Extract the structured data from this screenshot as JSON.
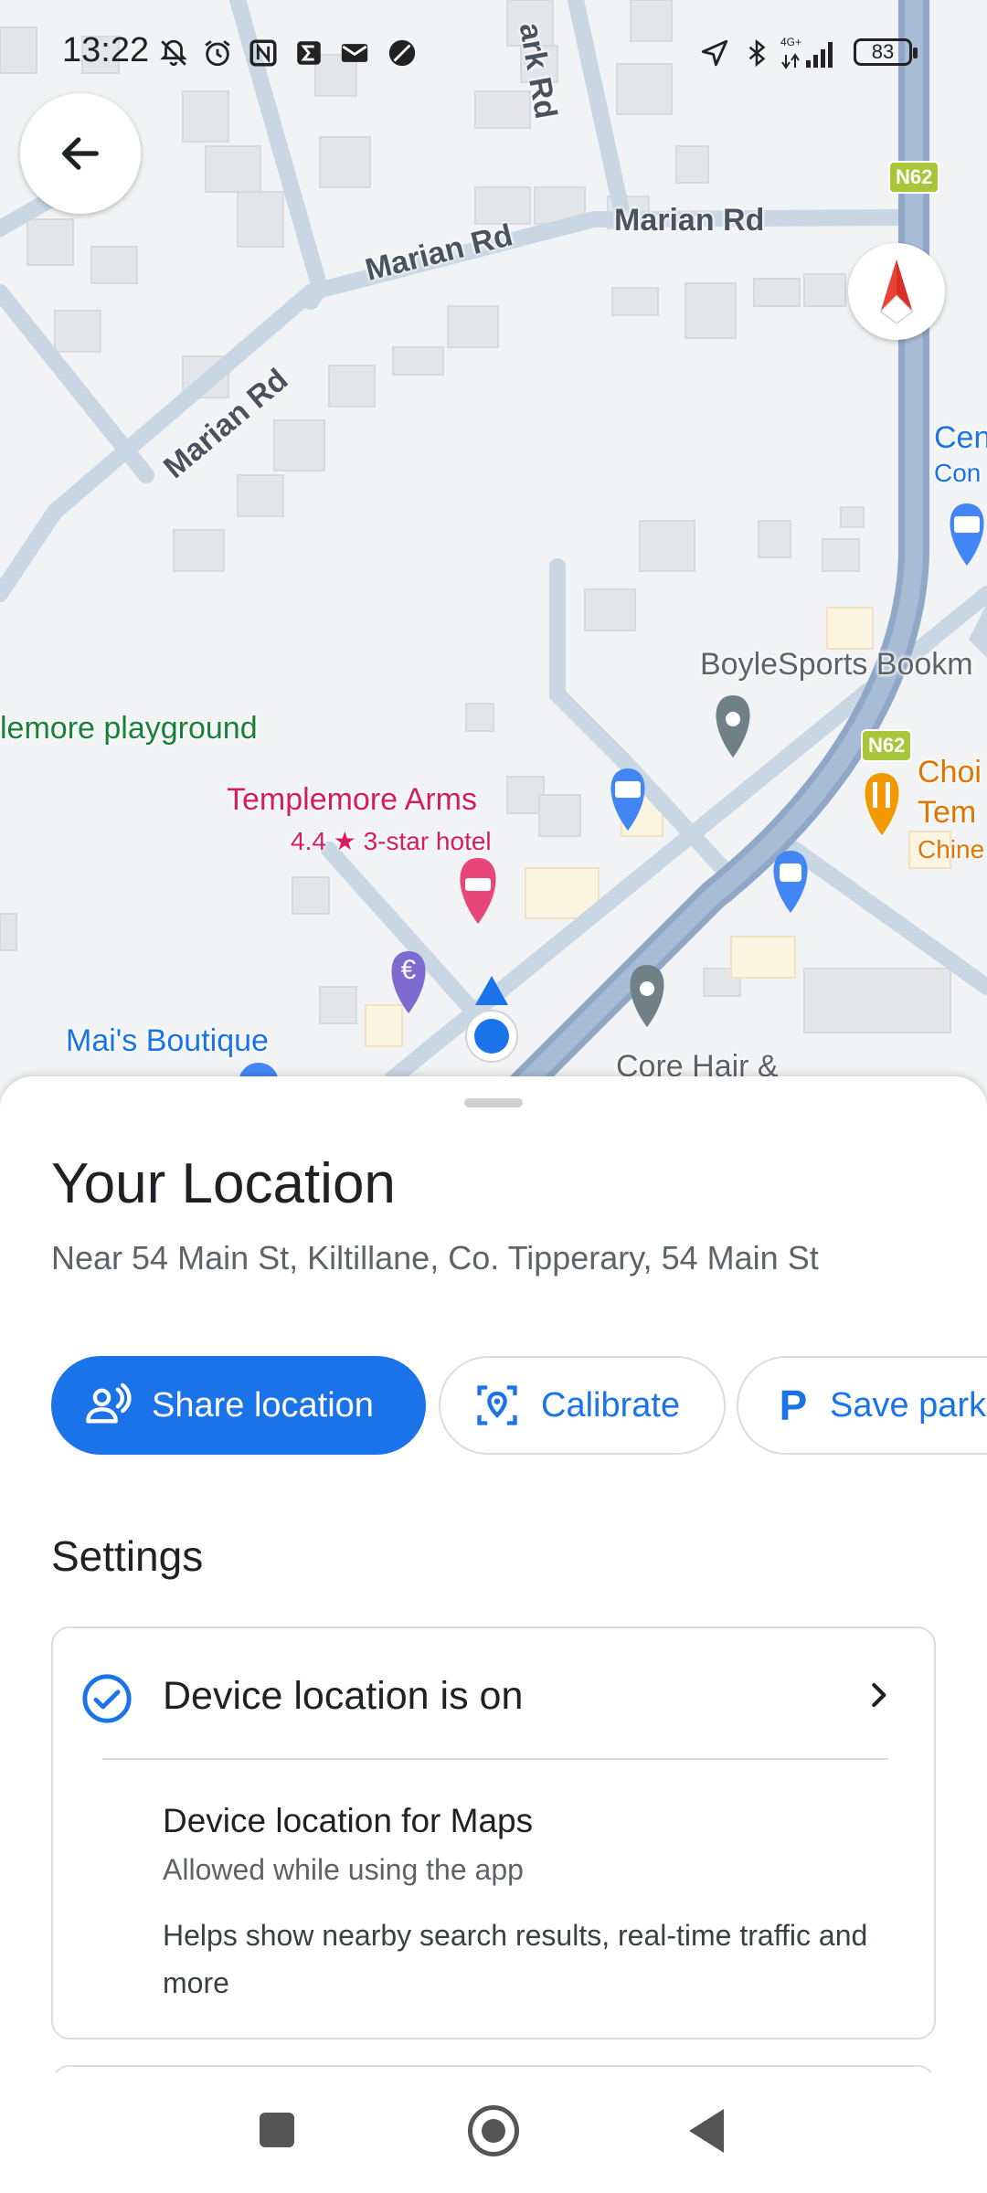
{
  "status_bar": {
    "time": "13:22",
    "battery": "83",
    "network": "4G+",
    "icons": [
      "mute-icon",
      "alarm-icon",
      "nfc-icon",
      "sigma-icon",
      "mail-icon",
      "leaf-icon",
      "location-arrow-icon",
      "bluetooth-icon",
      "signal-icon",
      "battery-icon"
    ]
  },
  "map": {
    "road_labels": {
      "park_rd": "ark Rd",
      "marian_rd_1": "Marian Rd",
      "marian_rd_2": "Marian Rd",
      "marian_rd_3": "Marian Rd",
      "n62_a": "N62",
      "n62_b": "N62"
    },
    "pois": {
      "playground": "lemore playground",
      "hotel_name": "Templemore Arms",
      "hotel_rating": "4.4 ★ 3-star hotel",
      "boutique": "Mai's Boutique",
      "bookmaker": "BoyleSports Bookm",
      "restaurant_1": "Choi",
      "restaurant_2": "Tem",
      "restaurant_3": "Chine",
      "cen_1": "Cen",
      "cen_2": "Con",
      "hair": "Core Hair &"
    },
    "colors": {
      "road_main": "#8fa8c8",
      "road_minor": "#c9d6e3",
      "building": "#e3e5e8",
      "hotel_pink": "#e8457a",
      "food_orange": "#f29900",
      "shop_blue": "#4285f4",
      "bank_purple": "#7d6bd0",
      "park_green": "#188038"
    }
  },
  "sheet": {
    "title": "Your Location",
    "address": "Near 54 Main St, Kiltillane, Co. Tipperary, 54 Main St",
    "actions": {
      "share": "Share location",
      "calibrate": "Calibrate",
      "save_parking": "Save park"
    },
    "settings_heading": "Settings",
    "device_location": {
      "title": "Device location is on",
      "maps_title": "Device location for Maps",
      "maps_subtitle": "Allowed while using the app",
      "maps_description": "Helps show nearby search results, real-time traffic and more"
    }
  },
  "accent": "#1a73e8"
}
